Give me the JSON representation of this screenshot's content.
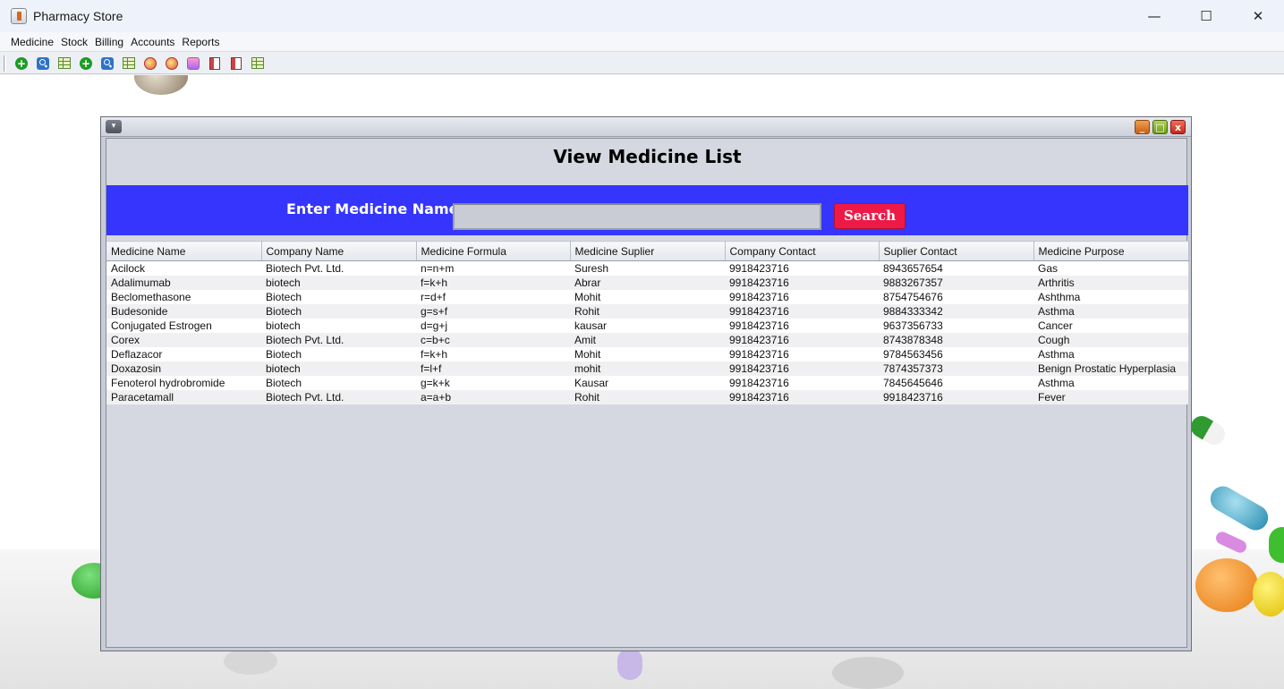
{
  "window": {
    "title": "Pharmacy Store",
    "controls": {
      "minimize": "—",
      "maximize": "☐",
      "close": "✕"
    }
  },
  "menubar": {
    "items": [
      "Medicine",
      "Stock",
      "Billing",
      "Accounts",
      "Reports"
    ]
  },
  "toolbar": {
    "buttons": [
      "add-icon",
      "search-icon",
      "table-icon",
      "add-icon",
      "search-icon",
      "table-icon",
      "pill-icon",
      "medicine-icon",
      "bag-icon",
      "book-icon",
      "book-icon",
      "table-icon"
    ]
  },
  "frame": {
    "menu_glyph": "▾",
    "min": "_",
    "max": "□",
    "close": "x"
  },
  "page": {
    "heading": "View Medicine List",
    "search_label": "Enter Medicine Name",
    "search_value": "",
    "search_button": "Search"
  },
  "table": {
    "columns": [
      "Medicine Name",
      "Company Name",
      "Medicine Formula",
      "Medicine Suplier",
      "Company Contact",
      "Suplier Contact",
      "Medicine Purpose"
    ],
    "rows": [
      [
        "Acilock",
        "Biotech Pvt. Ltd.",
        "n=n+m",
        "Suresh",
        "9918423716",
        "8943657654",
        "Gas"
      ],
      [
        "Adalimumab",
        "biotech",
        "f=k+h",
        "Abrar",
        "9918423716",
        "9883267357",
        "Arthritis"
      ],
      [
        "Beclomethasone",
        "Biotech",
        "r=d+f",
        "Mohit",
        "9918423716",
        "8754754676",
        "Ashthma"
      ],
      [
        "Budesonide",
        "Biotech",
        "g=s+f",
        "Rohit",
        "9918423716",
        "9884333342",
        "Asthma"
      ],
      [
        "Conjugated Estrogen",
        "biotech",
        "d=g+j",
        "kausar",
        "9918423716",
        "9637356733",
        "Cancer"
      ],
      [
        "Corex",
        "Biotech Pvt. Ltd.",
        "c=b+c",
        "Amit",
        "9918423716",
        "8743878348",
        "Cough"
      ],
      [
        "Deflazacor",
        "Biotech",
        "f=k+h",
        "Mohit",
        "9918423716",
        "9784563456",
        "Asthma"
      ],
      [
        "Doxazosin",
        "biotech",
        "f=l+f",
        "mohit",
        "9918423716",
        "7874357373",
        "Benign Prostatic Hyperplasia"
      ],
      [
        "Fenoterol hydrobromide",
        "Biotech",
        "g=k+k",
        "Kausar",
        "9918423716",
        "7845645646",
        "Asthma"
      ],
      [
        "Paracetamall",
        "Biotech Pvt. Ltd.",
        "a=a+b",
        "Rohit",
        "9918423716",
        "9918423716",
        "Fever"
      ]
    ]
  },
  "colors": {
    "search_panel": "#3535fd",
    "search_button": "#ed1a47",
    "content_bg": "#d5d8e0"
  }
}
